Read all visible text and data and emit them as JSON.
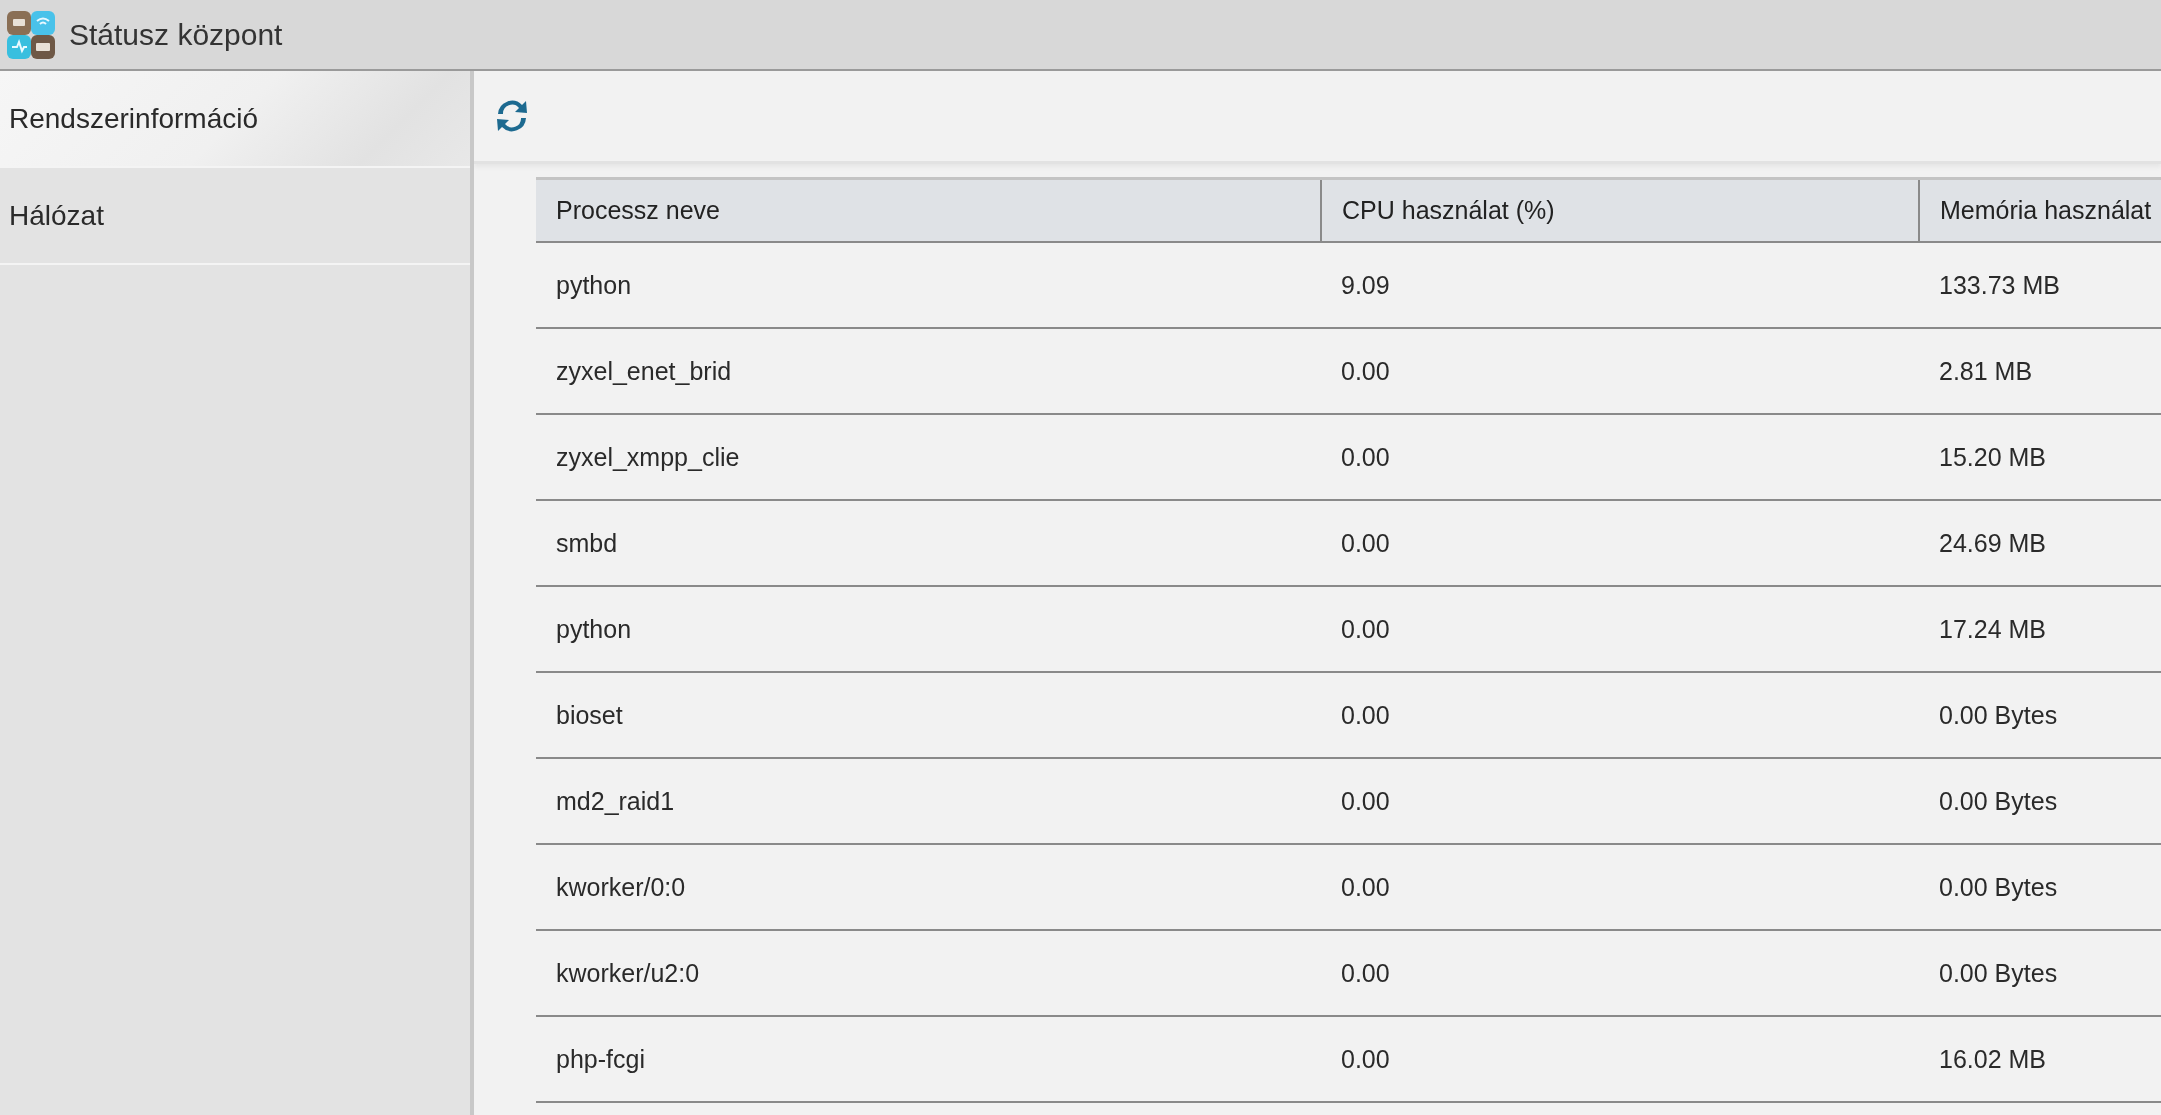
{
  "window": {
    "title": "Státusz központ"
  },
  "sidebar": {
    "items": [
      {
        "label": "Rendszerinformáció",
        "selected": true
      },
      {
        "label": "Hálózat",
        "selected": false
      }
    ]
  },
  "table": {
    "columns": [
      "Processz neve",
      "CPU használat (%)",
      "Memória használat"
    ],
    "rows": [
      [
        "python",
        "9.09",
        "133.73 MB"
      ],
      [
        "zyxel_enet_brid",
        "0.00",
        "2.81 MB"
      ],
      [
        "zyxel_xmpp_clie",
        "0.00",
        "15.20 MB"
      ],
      [
        "smbd",
        "0.00",
        "24.69 MB"
      ],
      [
        "python",
        "0.00",
        "17.24 MB"
      ],
      [
        "bioset",
        "0.00",
        "0.00 Bytes"
      ],
      [
        "md2_raid1",
        "0.00",
        "0.00 Bytes"
      ],
      [
        "kworker/0:0",
        "0.00",
        "0.00 Bytes"
      ],
      [
        "kworker/u2:0",
        "0.00",
        "0.00 Bytes"
      ],
      [
        "php-fcgi",
        "0.00",
        "16.02 MB"
      ]
    ]
  }
}
